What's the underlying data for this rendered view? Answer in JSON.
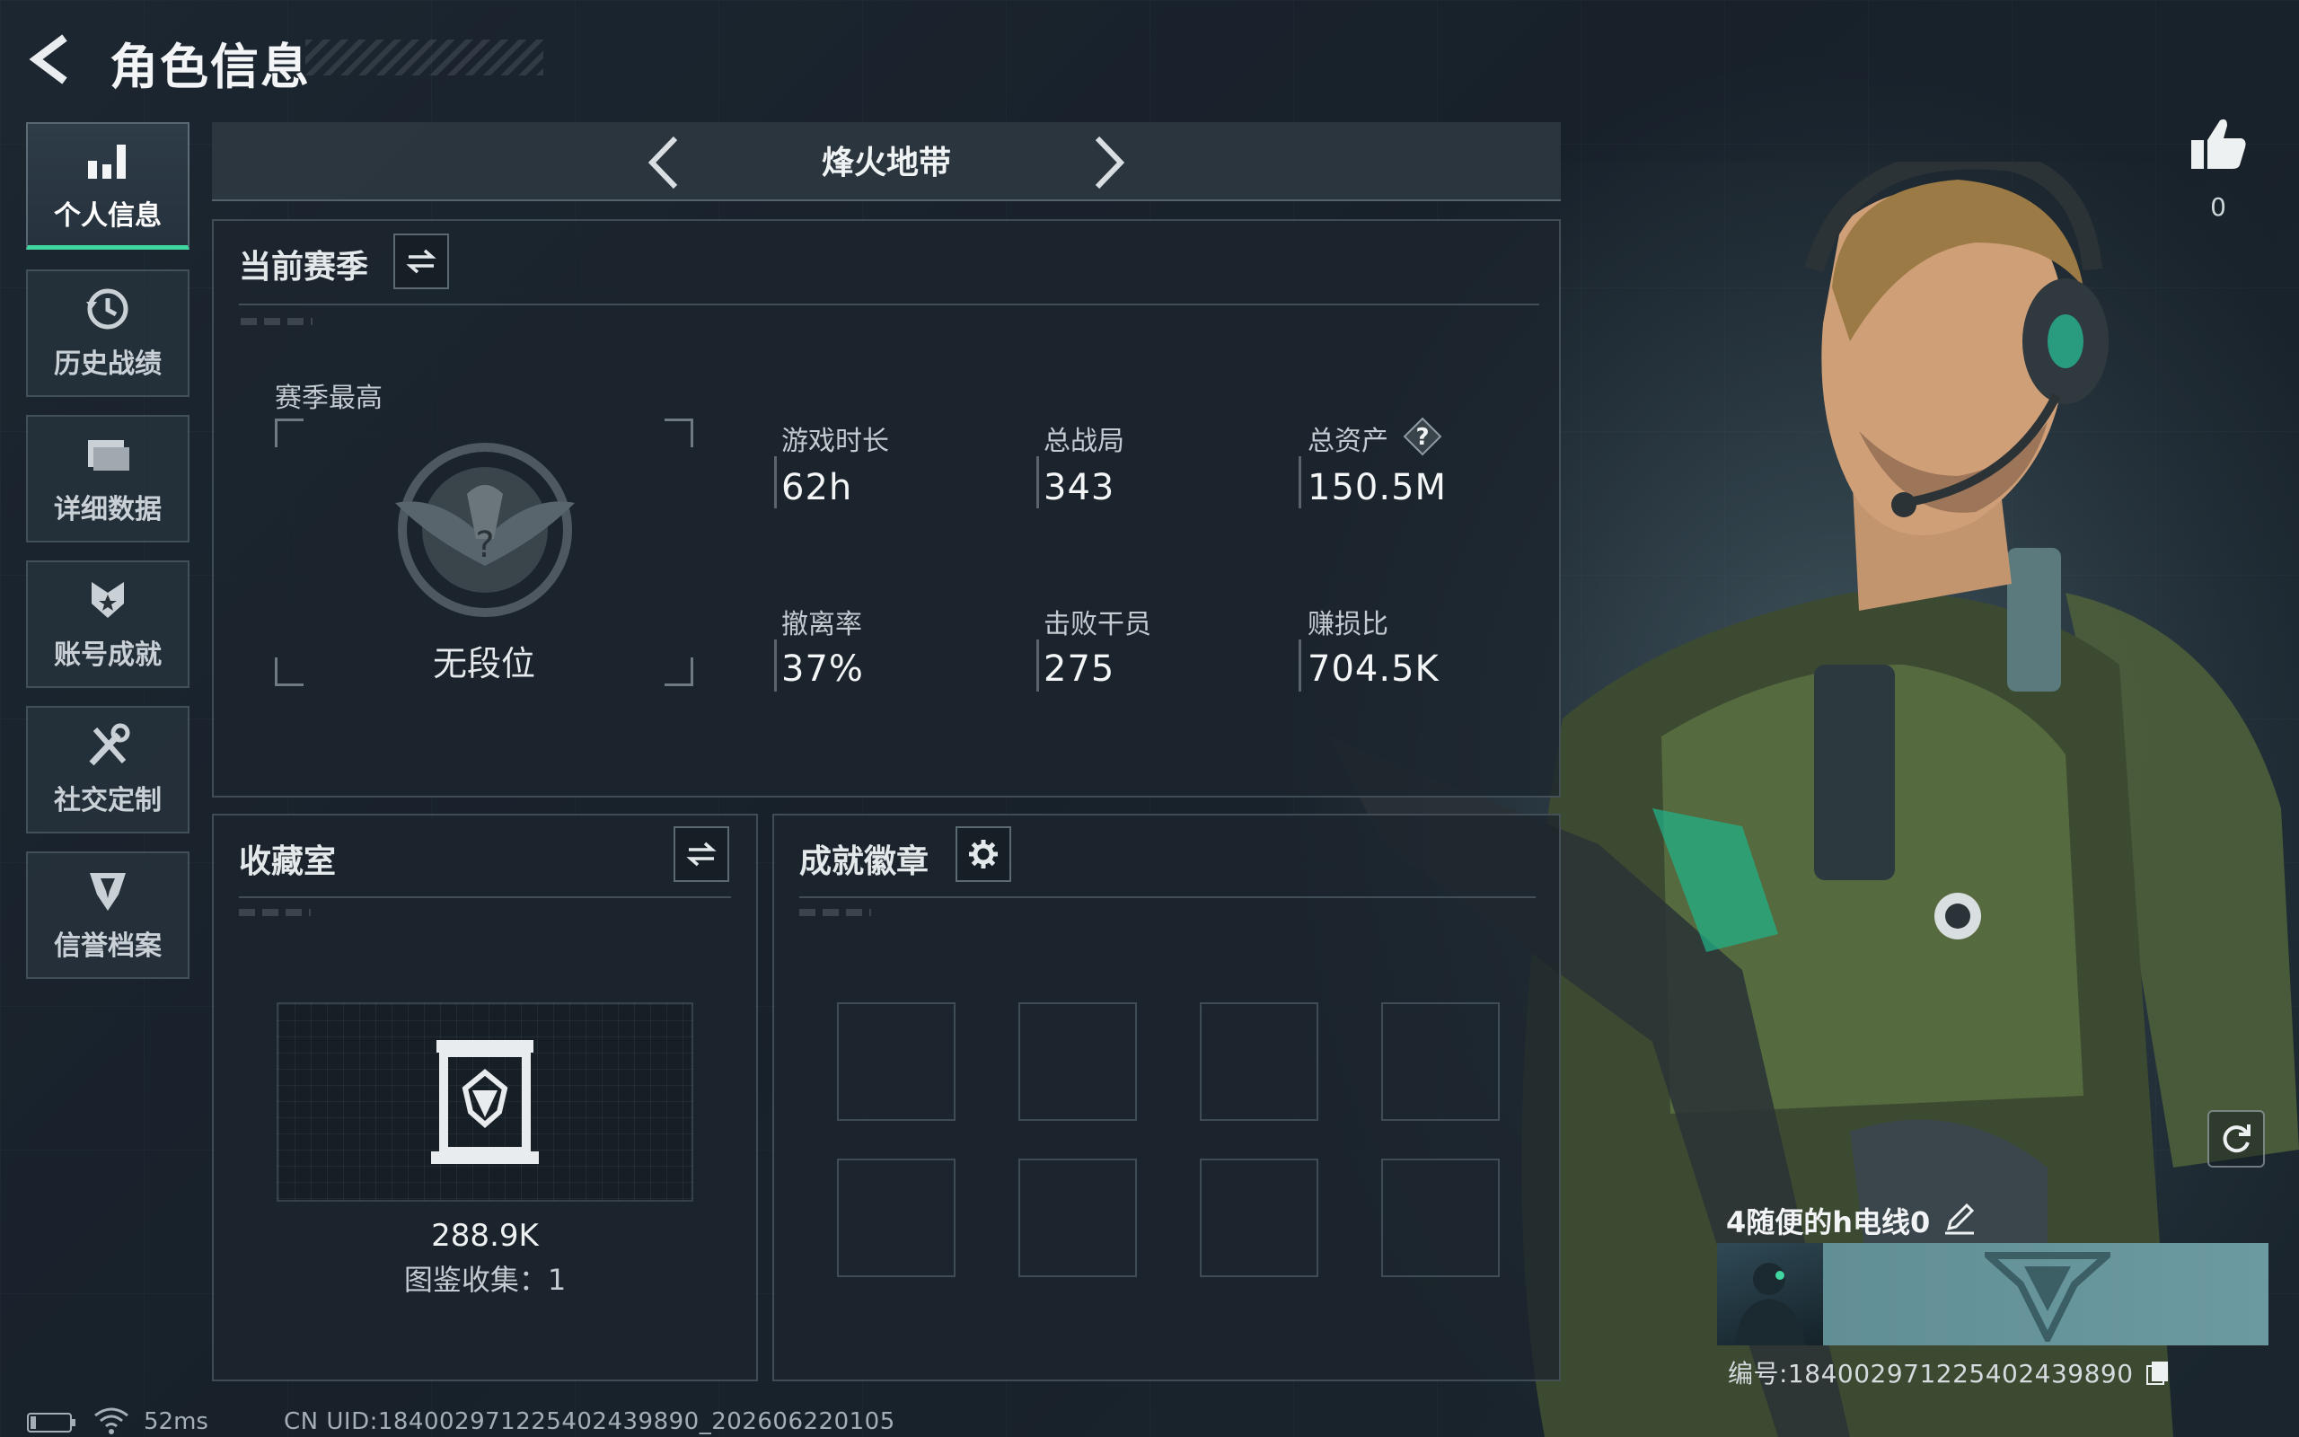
{
  "header": {
    "title": "角色信息"
  },
  "sidebar": {
    "items": [
      {
        "label": "个人信息",
        "icon": "bar-chart-icon",
        "active": true
      },
      {
        "label": "历史战绩",
        "icon": "history-clock-icon",
        "active": false
      },
      {
        "label": "详细数据",
        "icon": "folder-icon",
        "active": false
      },
      {
        "label": "账号成就",
        "icon": "achievement-badge-icon",
        "active": false
      },
      {
        "label": "社交定制",
        "icon": "tools-icon",
        "active": false
      },
      {
        "label": "信誉档案",
        "icon": "shield-emblem-icon",
        "active": false
      }
    ]
  },
  "mode": {
    "name": "烽火地带"
  },
  "season": {
    "title": "当前赛季",
    "best_label": "赛季最高",
    "rank_name": "无段位",
    "stats": [
      {
        "label": "游戏时长",
        "value": "62h"
      },
      {
        "label": "总战局",
        "value": "343"
      },
      {
        "label": "总资产",
        "value": "150.5M",
        "has_help": true
      },
      {
        "label": "撤离率",
        "value": "37%"
      },
      {
        "label": "击败干员",
        "value": "275"
      },
      {
        "label": "赚损比",
        "value": "704.5K"
      }
    ]
  },
  "collection": {
    "title": "收藏室",
    "value": "288.9K",
    "collected_text": "图鉴收集：1"
  },
  "badges": {
    "title": "成就徽章"
  },
  "profile": {
    "like_count": "0",
    "player_name": "4随便的h电线0",
    "player_id": "编号:184002971225402439890"
  },
  "status": {
    "ping": "52ms",
    "uid": "CN UID:184002971225402439890_202606220105"
  },
  "colors": {
    "accent": "#3fd6a0",
    "panel_bg": "#1c252d",
    "banner": "#6b9aa0"
  }
}
